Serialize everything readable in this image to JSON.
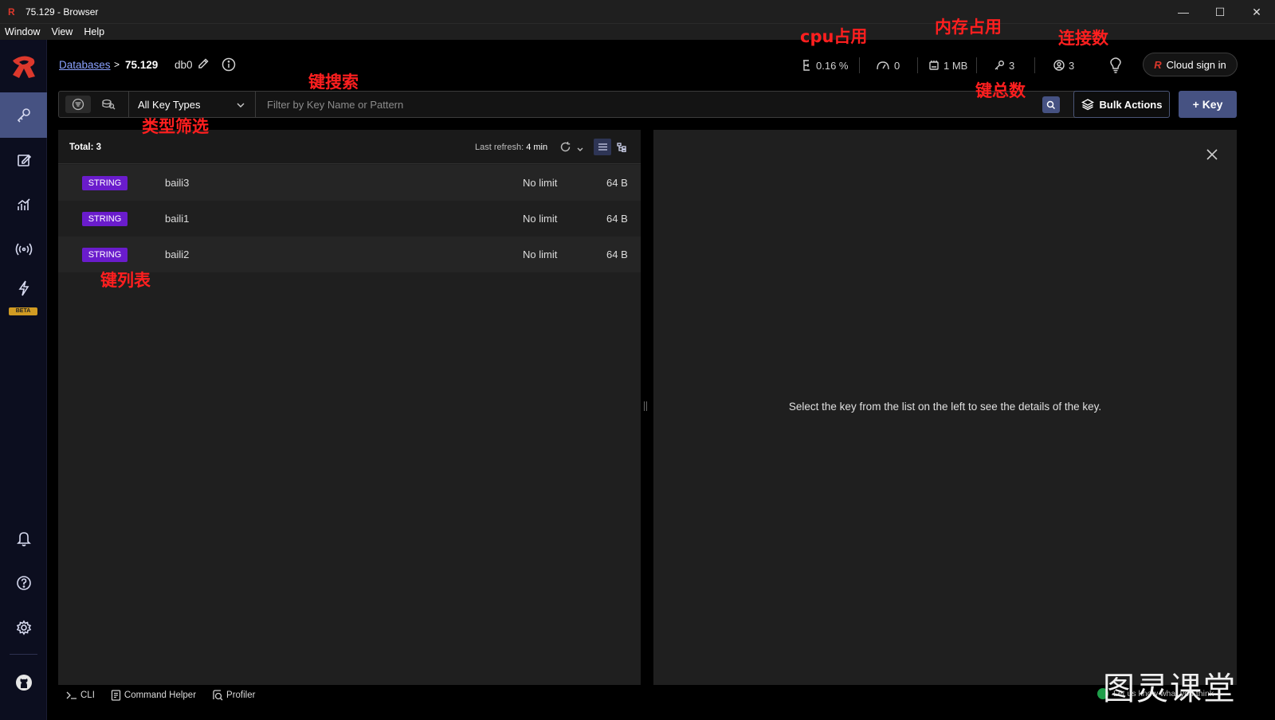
{
  "window": {
    "title": "75.129 - Browser",
    "menu": [
      "Window",
      "View",
      "Help"
    ],
    "controls": {
      "minimize": "—",
      "maximize": "☐",
      "close": "✕"
    }
  },
  "header": {
    "breadcrumb_link": "Databases",
    "breadcrumb_sep": ">",
    "host": "75.129",
    "db": "db0",
    "stats": {
      "cpu": "0.16 %",
      "ops": "0",
      "memory": "1 MB",
      "keys": "3",
      "clients": "3"
    },
    "cloud_sign_in": "Cloud sign in"
  },
  "filter": {
    "type_select": "All Key Types",
    "search_placeholder": "Filter by Key Name or Pattern",
    "bulk_actions": "Bulk Actions",
    "add_key": "+ Key"
  },
  "key_list": {
    "total": "Total: 3",
    "refresh_label": "Last refresh:",
    "refresh_value": "4 min",
    "rows": [
      {
        "type": "STRING",
        "name": "baili3",
        "ttl": "No limit",
        "size": "64 B"
      },
      {
        "type": "STRING",
        "name": "baili1",
        "ttl": "No limit",
        "size": "64 B"
      },
      {
        "type": "STRING",
        "name": "baili2",
        "ttl": "No limit",
        "size": "64 B"
      }
    ]
  },
  "details": {
    "empty_message": "Select the key from the list on the left to see the details of the key."
  },
  "bottom_bar": {
    "cli": "CLI",
    "command_helper": "Command Helper",
    "profiler": "Profiler",
    "feedback": "Let us know what you think"
  },
  "sidebar": {
    "beta": "BETA"
  },
  "annotations": {
    "cpu": "cpu占用",
    "memory": "内存占用",
    "connections": "连接数",
    "key_search": "键搜索",
    "key_total": "键总数",
    "type_filter": "类型筛选",
    "key_list": "键列表"
  },
  "watermark": "图灵课堂",
  "colors": {
    "accent": "#465282",
    "string_badge": "#6a1ccc",
    "brand_red": "#dc382c",
    "annotation_red": "#ff1f1f"
  }
}
